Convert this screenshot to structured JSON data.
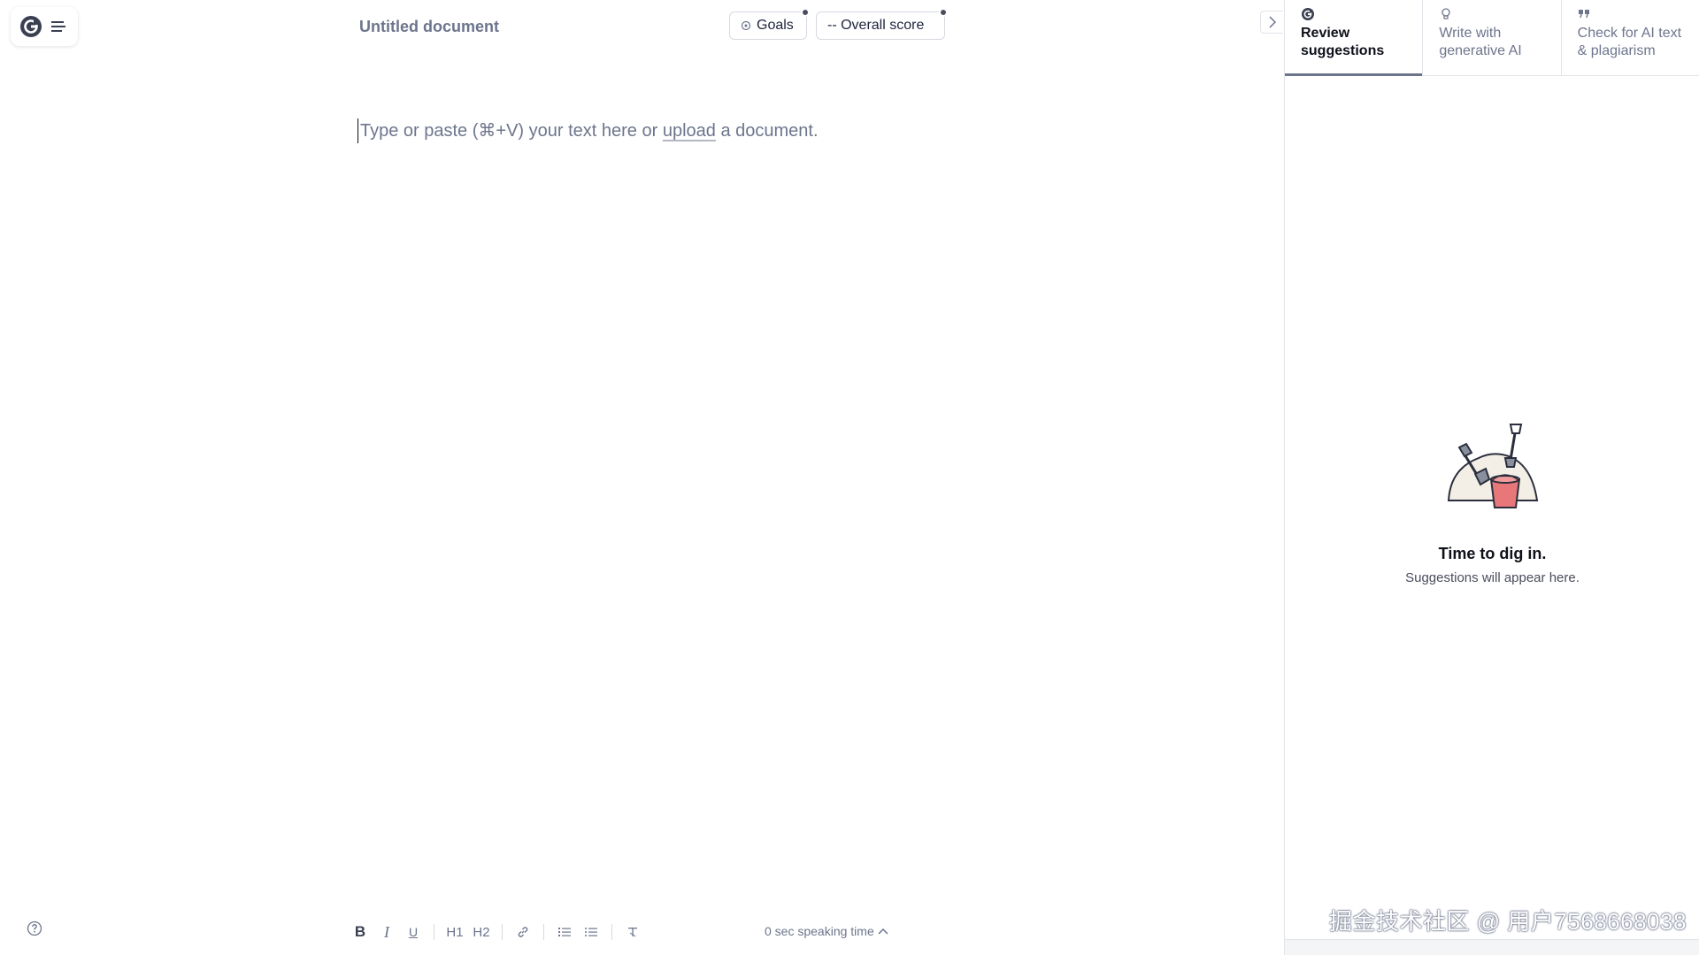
{
  "document": {
    "title": "Untitled document",
    "placeholder_before": "Type or paste (⌘+V) your text here or ",
    "placeholder_link": "upload",
    "placeholder_after": " a document."
  },
  "header": {
    "goals_label": "Goals",
    "score_label": "-- Overall score"
  },
  "toolbar": {
    "bold": "B",
    "italic": "I",
    "underline": "U",
    "h1": "H1",
    "h2": "H2",
    "speaking_time": "0 sec speaking time"
  },
  "panel": {
    "tabs": [
      {
        "label": "Review suggestions",
        "icon": "grammarly-logo-icon",
        "active": true
      },
      {
        "label": "Write with generative AI",
        "icon": "lightbulb-icon",
        "active": false
      },
      {
        "label": "Check for AI text & plagiarism",
        "icon": "quote-icon",
        "active": false
      }
    ],
    "empty_title": "Time to dig in.",
    "empty_subtitle": "Suggestions will appear here."
  },
  "watermark": "掘金技术社区 @ 用户7568668038",
  "colors": {
    "muted_text": "#6d758d",
    "border": "#e2e4ea",
    "bucket": "#e8777a",
    "mound": "#f3efe6"
  }
}
